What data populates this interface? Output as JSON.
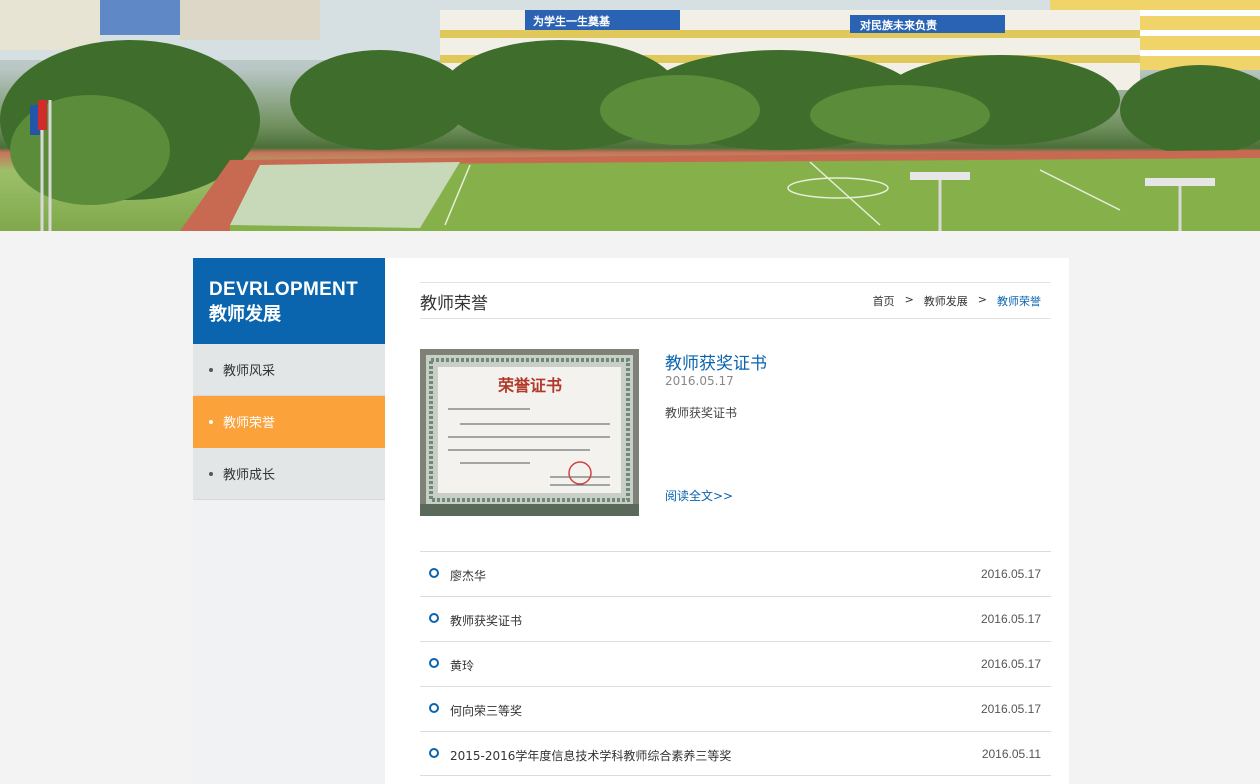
{
  "banner": {
    "sign_left": "为学生一生奠基",
    "sign_right": "对民族未来负责"
  },
  "sidebar": {
    "heading_en": "DEVRLOPMENT",
    "heading_cn": "教师发展",
    "items": [
      {
        "label": "教师风采",
        "active": false
      },
      {
        "label": "教师荣誉",
        "active": true
      },
      {
        "label": "教师成长",
        "active": false
      }
    ]
  },
  "main": {
    "title": "教师荣誉",
    "breadcrumb": [
      "首页",
      "教师发展",
      "教师荣誉"
    ],
    "breadcrumb_sep": ">",
    "feature": {
      "title": "教师获奖证书",
      "date": "2016.05.17",
      "desc": "教师获奖证书",
      "more": "阅读全文>>",
      "certificate_heading": "荣誉证书"
    },
    "list": [
      {
        "name": "廖杰华",
        "date": "2016.05.17"
      },
      {
        "name": "教师获奖证书",
        "date": "2016.05.17"
      },
      {
        "name": "黄玲",
        "date": "2016.05.17"
      },
      {
        "name": "何向荣三等奖",
        "date": "2016.05.17"
      },
      {
        "name": "2015-2016学年度信息技术学科教师综合素养三等奖",
        "date": "2016.05.11"
      }
    ]
  },
  "colors": {
    "brand_blue": "#0a64ae",
    "active_orange": "#fba23a"
  }
}
